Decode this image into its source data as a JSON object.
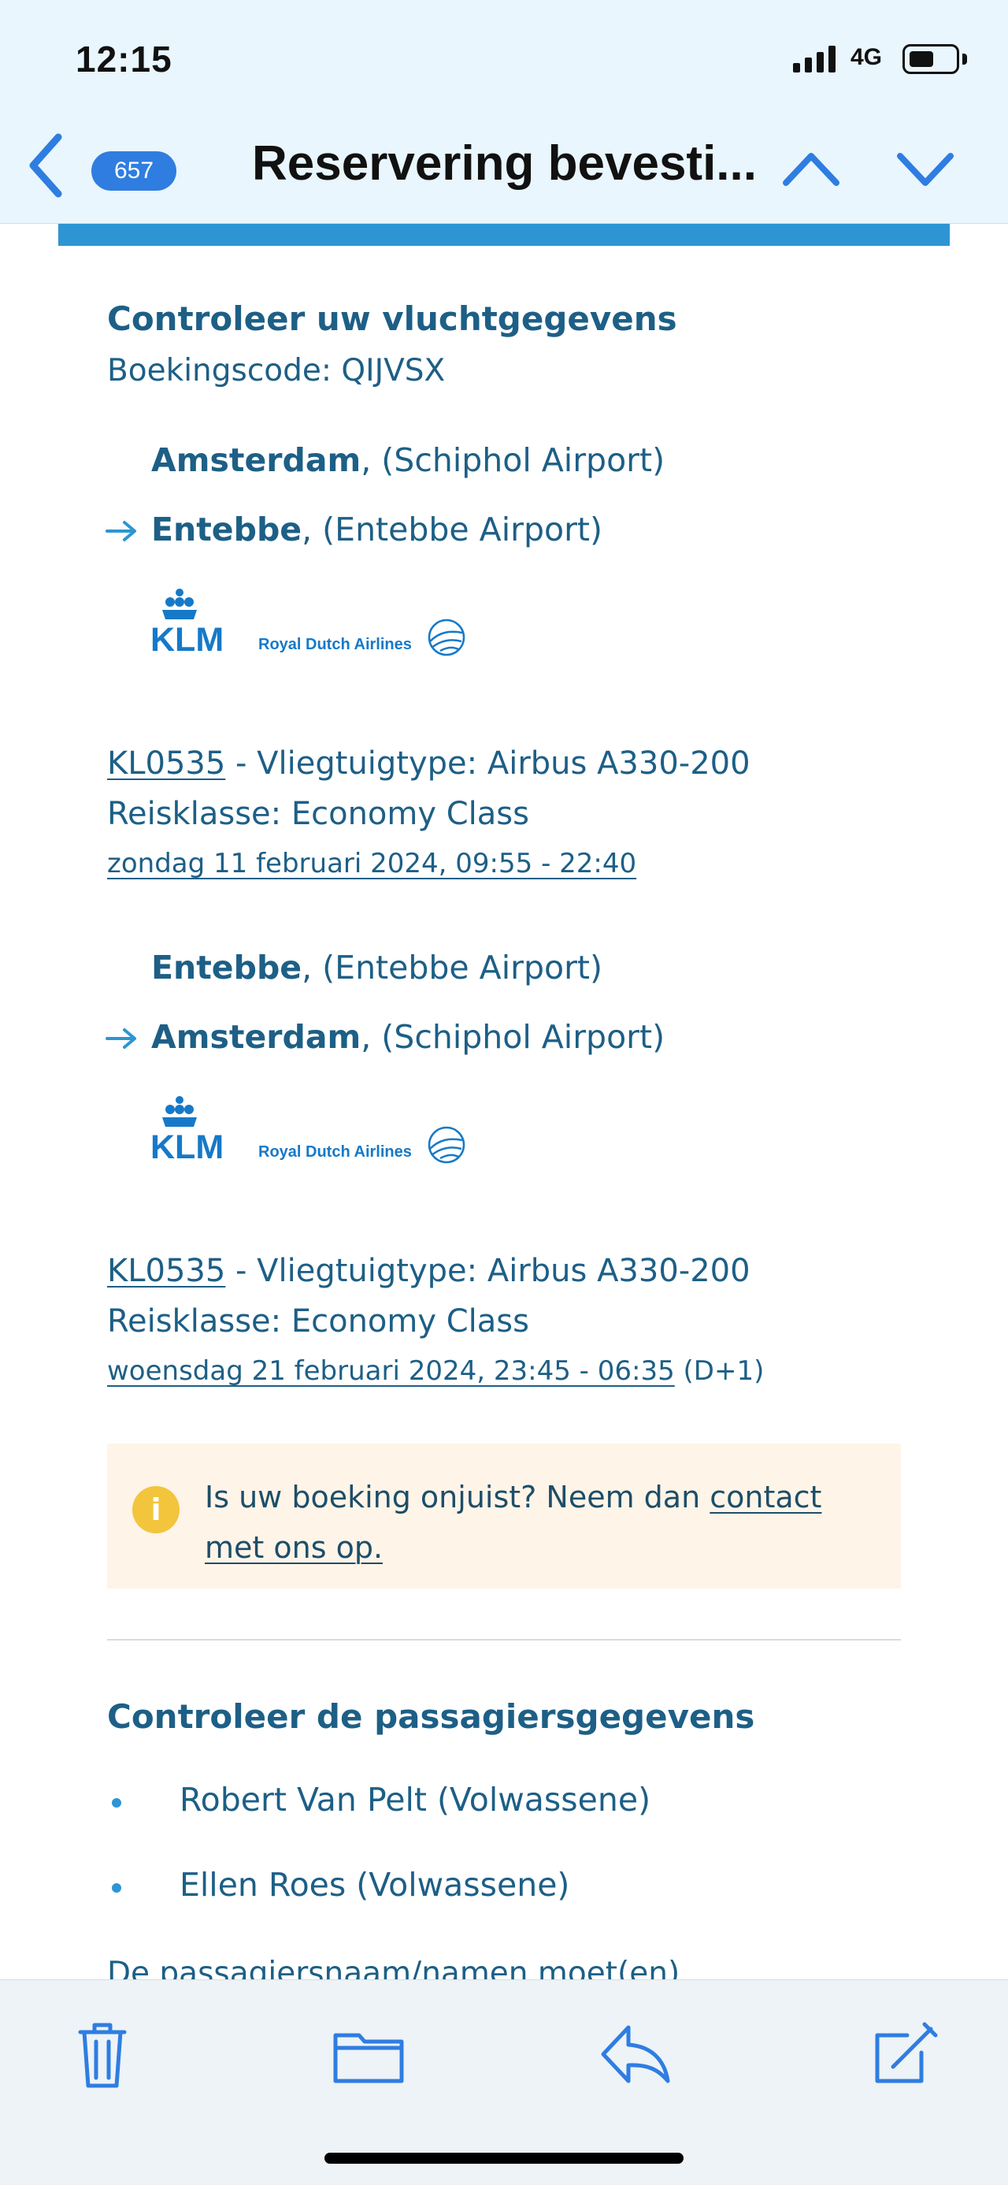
{
  "status_bar": {
    "time": "12:15",
    "network": "4G",
    "icons": [
      "cellular-signal-icon",
      "battery-icon"
    ]
  },
  "mail_header": {
    "unread_count": "657",
    "subject": "Reservering bevesti...",
    "icons": [
      "chevron-left-icon",
      "chevron-up-icon",
      "chevron-down-icon"
    ]
  },
  "colors": {
    "accent": "#2d95d4",
    "text": "#1d5f86",
    "notice_background": "#fff4e8",
    "notice_icon": "#f2c53d"
  },
  "email": {
    "section_title": "Controleer uw vluchtgegevens",
    "booking_code": "Boekingscode: QIJVSX",
    "flights": [
      {
        "origin_city": "Amsterdam",
        "origin_airport": ", (Schiphol Airport)",
        "destination_city": "Entebbe",
        "destination_airport": ", (Entebbe Airport)",
        "airline_logo": "KLM",
        "airline_tagline": "Royal Dutch Airlines",
        "flight_number": "KL0535",
        "aircraft": " - Vliegtuigtype: Airbus A330-200",
        "travel_class": "Reisklasse: Economy Class",
        "schedule": "zondag 11 februari 2024, 09:55 - 22:40",
        "schedule_suffix": ""
      },
      {
        "origin_city": "Entebbe",
        "origin_airport": ", (Entebbe Airport)",
        "destination_city": "Amsterdam",
        "destination_airport": ", (Schiphol Airport)",
        "airline_logo": "KLM",
        "airline_tagline": "Royal Dutch Airlines",
        "flight_number": "KL0535",
        "aircraft": " - Vliegtuigtype: Airbus A330-200",
        "travel_class": "Reisklasse: Economy Class",
        "schedule": "woensdag 21 februari 2024, 23:45 - 06:35",
        "schedule_suffix": " (D+1)"
      }
    ],
    "notice": {
      "icon": "info-icon",
      "text": "Is uw boeking onjuist? Neem dan ",
      "link": "contact met ons op."
    },
    "passengers": {
      "section_title": "Controleer de passagiersgegevens",
      "items": [
        "Robert Van Pelt (Volwassene)",
        "Ellen Roes (Volwassene)"
      ],
      "partial_text": "De passagiersnaam/namen moet(en)"
    }
  },
  "toolbar": {
    "icons": [
      "trash-icon",
      "folder-icon",
      "reply-icon",
      "compose-icon"
    ]
  }
}
